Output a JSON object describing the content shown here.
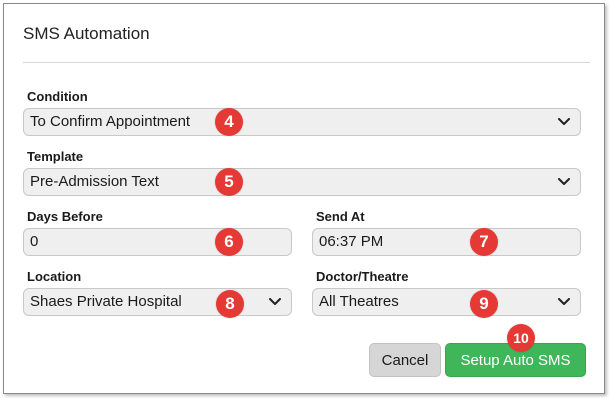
{
  "dialog": {
    "title": "SMS Automation"
  },
  "condition": {
    "label": "Condition",
    "value": "To Confirm Appointment",
    "badge": "4"
  },
  "template": {
    "label": "Template",
    "value": "Pre-Admission Text",
    "badge": "5"
  },
  "days_before": {
    "label": "Days Before",
    "value": "0",
    "badge": "6"
  },
  "send_at": {
    "label": "Send At",
    "value": "06:37 PM",
    "badge": "7"
  },
  "location": {
    "label": "Location",
    "value": "Shaes Private Hospital",
    "badge": "8"
  },
  "doctor_theatre": {
    "label": "Doctor/Theatre",
    "value": "All Theatres",
    "badge": "9"
  },
  "buttons": {
    "cancel_label": "Cancel",
    "setup_label": "Setup Auto SMS",
    "setup_badge": "10"
  },
  "colors": {
    "badge": "#e53935",
    "primary_button": "#3fb65a",
    "cancel_button": "#d6d6d6",
    "field_background": "#efefef"
  },
  "icons": {
    "dropdown": "chevron-down-icon"
  }
}
